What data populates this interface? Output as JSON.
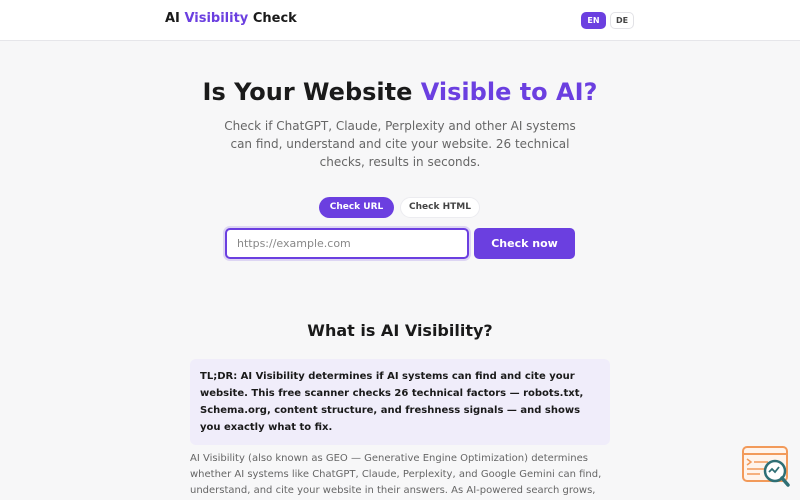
{
  "header": {
    "logo_prefix": "AI",
    "logo_accent": "Visibility",
    "logo_suffix": "Check",
    "languages": [
      {
        "label": "EN",
        "active": true
      },
      {
        "label": "DE",
        "active": false
      }
    ]
  },
  "hero": {
    "title_prefix": "Is Your Website",
    "title_accent": "Visible to AI?",
    "subtitle": "Check if ChatGPT, Claude, Perplexity and other AI systems can find, understand and cite your website. 26 technical checks, results in seconds."
  },
  "checker": {
    "tabs": [
      {
        "label": "Check URL",
        "active": true
      },
      {
        "label": "Check HTML",
        "active": false
      }
    ],
    "input_placeholder": "https://example.com",
    "input_value": "",
    "submit_label": "Check now"
  },
  "info": {
    "title": "What is AI Visibility?",
    "tldr": "TL;DR: AI Visibility determines if AI systems can find and cite your website. This free scanner checks 26 technical factors — robots.txt, Schema.org, content structure, and freshness signals — and shows you exactly what to fix.",
    "body": "AI Visibility (also known as GEO — Generative Engine Optimization) determines whether AI systems like ChatGPT, Claude, Perplexity, and Google Gemini can find, understand, and cite your website in their answers. As AI-powered search grows, websites that are"
  },
  "colors": {
    "accent": "#6b3fe0",
    "background": "#f7f7f8",
    "tldr_background": "#f0edfa",
    "widget_orange": "#f29a5a",
    "widget_teal": "#2f6f75"
  },
  "icons": {
    "floating_widget": "search-analytics-icon"
  }
}
